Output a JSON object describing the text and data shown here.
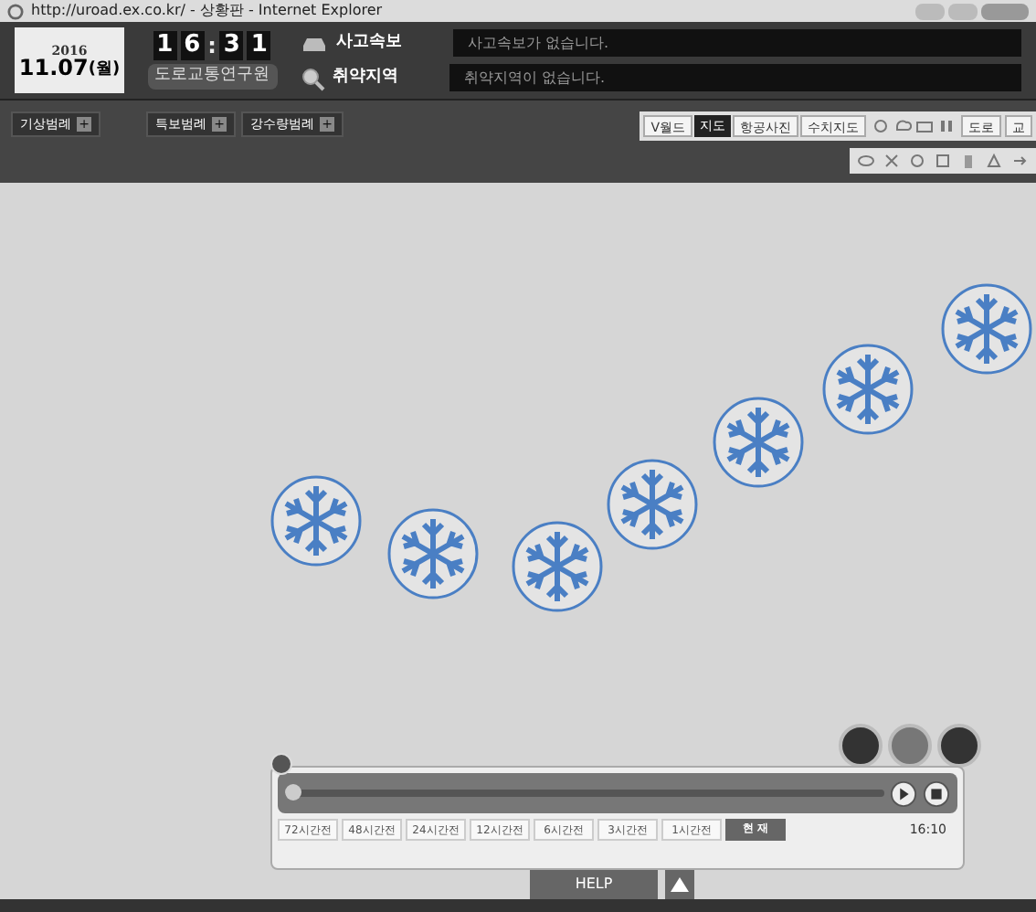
{
  "window": {
    "title": "http://uroad.ex.co.kr/ - 상황판 - Internet Explorer"
  },
  "header": {
    "year": "2016",
    "date": "11.07",
    "weekday": "(월)",
    "clock": [
      "1",
      "6",
      ":",
      "3",
      "1"
    ],
    "org": "도로교통연구원",
    "alerts": [
      {
        "kind": "accident",
        "label": "사고속보",
        "message": "사고속보가 없습니다."
      },
      {
        "kind": "vulnerable",
        "label": "취약지역",
        "message": "취약지역이 없습니다."
      }
    ]
  },
  "legends": [
    "기상범례",
    "특보범례",
    "강수량범례"
  ],
  "legend_toggle": "+",
  "map_types": [
    {
      "label": "V월드",
      "selected": false
    },
    {
      "label": "지도",
      "selected": true
    },
    {
      "label": "항공사진",
      "selected": false
    },
    {
      "label": "수치지도",
      "selected": false
    }
  ],
  "layer_buttons": [
    "도로",
    "교"
  ],
  "timeline": {
    "level": 0.0,
    "time": "16:10",
    "steps": [
      {
        "label": "72시간전",
        "selected": false
      },
      {
        "label": "48시간전",
        "selected": false
      },
      {
        "label": "24시간전",
        "selected": false
      },
      {
        "label": "12시간전",
        "selected": false
      },
      {
        "label": "6시간전",
        "selected": false
      },
      {
        "label": "3시간전",
        "selected": false
      },
      {
        "label": "1시간전",
        "selected": false
      },
      {
        "label": "현 재",
        "selected": true
      }
    ]
  },
  "help": "HELP"
}
